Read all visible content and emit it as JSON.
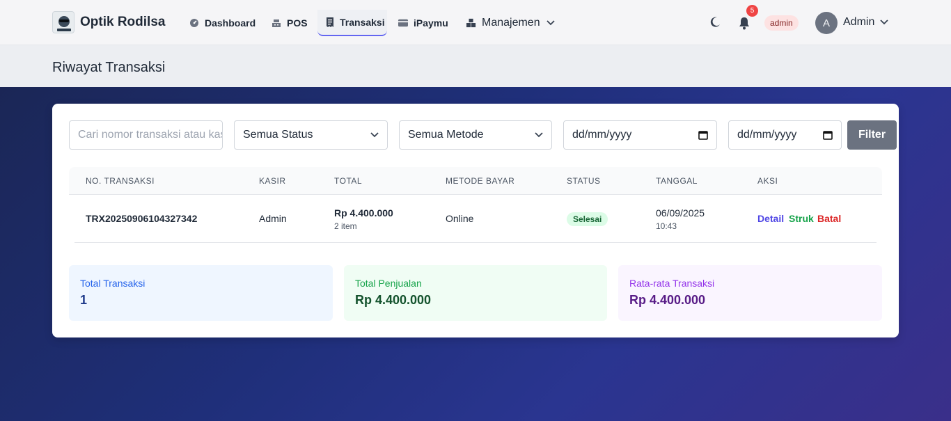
{
  "brand": {
    "name": "Optik Rodilsa"
  },
  "nav": {
    "items": [
      {
        "label": "Dashboard",
        "icon": "dashboard-gauge-icon"
      },
      {
        "label": "POS",
        "icon": "cash-register-icon"
      },
      {
        "label": "Transaksi",
        "icon": "receipt-icon",
        "active": true
      },
      {
        "label": "iPaymu",
        "icon": "credit-card-icon"
      },
      {
        "label": "Manajemen",
        "icon": "boxes-icon"
      }
    ]
  },
  "header_right": {
    "notification_count": "5",
    "role": "admin",
    "avatar_initial": "A",
    "user_name": "Admin"
  },
  "page": {
    "title": "Riwayat Transaksi"
  },
  "filters": {
    "search_placeholder": "Cari nomor transaksi atau kasir",
    "status_value": "Semua Status",
    "method_value": "Semua Metode",
    "date_from": "dd/mm/yyyy",
    "date_to": "dd/mm/yyyy",
    "filter_label": "Filter"
  },
  "table": {
    "headers": [
      "NO. TRANSAKSI",
      "KASIR",
      "TOTAL",
      "METODE BAYAR",
      "STATUS",
      "TANGGAL",
      "AKSI"
    ],
    "rows": [
      {
        "no": "TRX20250906104327342",
        "kasir": "Admin",
        "total": "Rp 4.400.000",
        "items": "2 item",
        "metode": "Online",
        "status": "Selesai",
        "tanggal": "06/09/2025",
        "jam": "10:43",
        "actions": [
          "Detail",
          "Struk",
          "Batal"
        ]
      }
    ]
  },
  "stats": [
    {
      "label": "Total Transaksi",
      "value": "1",
      "color": "#2563eb"
    },
    {
      "label": "Total Penjualan",
      "value": "Rp 4.400.000",
      "color": "#16a34a"
    },
    {
      "label": "Rata-rata Transaksi",
      "value": "Rp 4.400.000",
      "color": "#9333ea"
    }
  ]
}
